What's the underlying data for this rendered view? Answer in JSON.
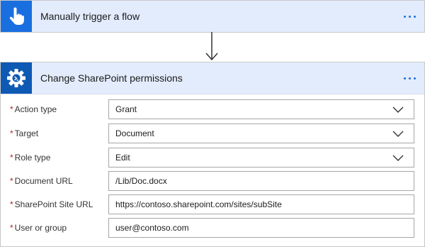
{
  "trigger": {
    "title": "Manually trigger a flow",
    "icon": "touch-hand-icon",
    "icon_bg": "#1a6fe0"
  },
  "action": {
    "title": "Change SharePoint permissions",
    "icon": "gear-icon",
    "icon_bg": "#0e59b3",
    "fields": [
      {
        "label": "Action type",
        "value": "Grant",
        "required": true,
        "type": "dropdown"
      },
      {
        "label": "Target",
        "value": "Document",
        "required": true,
        "type": "dropdown"
      },
      {
        "label": "Role type",
        "value": "Edit",
        "required": true,
        "type": "dropdown"
      },
      {
        "label": "Document URL",
        "value": "/Lib/Doc.docx",
        "required": true,
        "type": "text"
      },
      {
        "label": "SharePoint Site URL",
        "value": "https://contoso.sharepoint.com/sites/subSite",
        "required": true,
        "type": "text"
      },
      {
        "label": "User or group",
        "value": "user@contoso.com",
        "required": true,
        "type": "text"
      }
    ]
  },
  "required_marker": "*",
  "colors": {
    "header_bg": "#e3ecfc",
    "accent": "#1a6fe0",
    "required": "#a4262c"
  }
}
